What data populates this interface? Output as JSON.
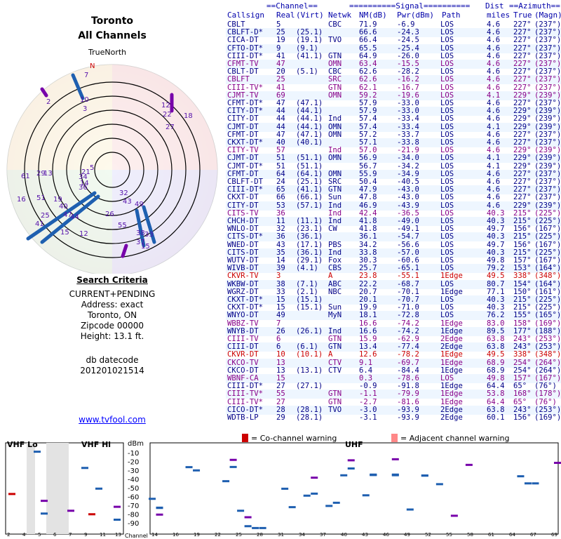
{
  "header": {
    "title1": "Toronto",
    "title2": "All Channels",
    "compass_label": "TrueNorth"
  },
  "polar_labels": [
    "N",
    "7",
    "10",
    "3",
    "2",
    "12",
    "22",
    "18",
    "27",
    "5",
    "61",
    "29",
    "13",
    "16",
    "51",
    "25",
    "36",
    "41",
    "19",
    "40",
    "47",
    "44",
    "32",
    "43",
    "49",
    "26",
    "55",
    "38",
    "33",
    "37",
    "15",
    "21",
    "34",
    "14",
    "12",
    "5",
    "15"
  ],
  "criteria": {
    "heading": "Search Criteria",
    "lines": [
      "CURRENT+PENDING",
      "Address: exact",
      "Toronto, ON",
      "Zipcode 00000",
      "Height: 13.1 ft."
    ],
    "db_lines": [
      "db datecode",
      "201201021514"
    ],
    "site_link": "www.tvfool.com"
  },
  "table": {
    "group_headers": {
      "channel": "==Channel==",
      "signal": "==========Signal==========",
      "dist": "Dist",
      "azimuth": "==Azimuth=="
    },
    "columns": [
      "Callsign",
      "Real",
      "(Virt)",
      "Netwk",
      "NM(dB)",
      "Pwr(dBm)",
      "Path",
      "miles",
      "True",
      "(Magn)"
    ],
    "rows": [
      [
        "CBLT",
        "5",
        "",
        "CBC",
        "71.9",
        "-6.9",
        "LOS",
        "4.6",
        "227°",
        "(237°)",
        "#008"
      ],
      [
        "CBLFT-D*",
        "25",
        "(25.1)",
        "",
        "66.6",
        "-24.3",
        "LOS",
        "4.6",
        "227°",
        "(237°)",
        "#008"
      ],
      [
        "CICA-DT",
        "19",
        "(19.1)",
        "TVO",
        "66.4",
        "-24.5",
        "LOS",
        "4.6",
        "227°",
        "(237°)",
        "#008"
      ],
      [
        "CFTO-DT*",
        "9",
        "(9.1)",
        "",
        "65.5",
        "-25.4",
        "LOS",
        "4.6",
        "227°",
        "(237°)",
        "#008"
      ],
      [
        "CIII-DT*",
        "41",
        "(41.1)",
        "GTN",
        "64.9",
        "-26.0",
        "LOS",
        "4.6",
        "227°",
        "(237°)",
        "#008"
      ],
      [
        "CFMT-TV",
        "47",
        "",
        "OMN",
        "63.4",
        "-15.5",
        "LOS",
        "4.6",
        "227°",
        "(237°)",
        "#808"
      ],
      [
        "CBLT-DT",
        "20",
        "(5.1)",
        "CBC",
        "62.6",
        "-28.2",
        "LOS",
        "4.6",
        "227°",
        "(237°)",
        "#008"
      ],
      [
        "CBLFT",
        "25",
        "",
        "SRC",
        "62.6",
        "-16.2",
        "LOS",
        "4.6",
        "227°",
        "(237°)",
        "#808"
      ],
      [
        "CIII-TV*",
        "41",
        "",
        "GTN",
        "62.1",
        "-16.7",
        "LOS",
        "4.6",
        "227°",
        "(237°)",
        "#808"
      ],
      [
        "CJMT-TV",
        "69",
        "",
        "OMN",
        "59.2",
        "-19.6",
        "LOS",
        "4.1",
        "229°",
        "(239°)",
        "#808"
      ],
      [
        "CFMT-DT*",
        "47",
        "(47.1)",
        "",
        "57.9",
        "-33.0",
        "LOS",
        "4.6",
        "227°",
        "(237°)",
        "#008"
      ],
      [
        "CITY-DT*",
        "44",
        "(44.1)",
        "",
        "57.9",
        "-33.0",
        "LOS",
        "4.6",
        "229°",
        "(239°)",
        "#008"
      ],
      [
        "CITY-DT",
        "44",
        "(44.1)",
        "Ind",
        "57.4",
        "-33.4",
        "LOS",
        "4.6",
        "229°",
        "(239°)",
        "#008"
      ],
      [
        "CJMT-DT",
        "44",
        "(44.1)",
        "OMN",
        "57.4",
        "-33.4",
        "LOS",
        "4.1",
        "229°",
        "(239°)",
        "#008"
      ],
      [
        "CFMT-DT",
        "47",
        "(47.1)",
        "OMN",
        "57.2",
        "-33.7",
        "LOS",
        "4.6",
        "227°",
        "(237°)",
        "#008"
      ],
      [
        "CKXT-DT*",
        "40",
        "(40.1)",
        "",
        "57.1",
        "-33.8",
        "LOS",
        "4.6",
        "227°",
        "(237°)",
        "#008"
      ],
      [
        "CITY-TV",
        "57",
        "",
        "Ind",
        "57.0",
        "-21.9",
        "LOS",
        "4.6",
        "229°",
        "(239°)",
        "#808"
      ],
      [
        "CJMT-DT",
        "51",
        "(51.1)",
        "OMN",
        "56.9",
        "-34.0",
        "LOS",
        "4.1",
        "229°",
        "(239°)",
        "#008"
      ],
      [
        "CJMT-DT*",
        "51",
        "(51.1)",
        "",
        "56.7",
        "-34.2",
        "LOS",
        "4.1",
        "229°",
        "(239°)",
        "#008"
      ],
      [
        "CFMT-DT",
        "64",
        "(64.1)",
        "OMN",
        "55.9",
        "-34.9",
        "LOS",
        "4.6",
        "227°",
        "(237°)",
        "#008"
      ],
      [
        "CBLFT-DT",
        "24",
        "(25.1)",
        "SRC",
        "50.4",
        "-40.5",
        "LOS",
        "4.6",
        "227°",
        "(237°)",
        "#008"
      ],
      [
        "CIII-DT*",
        "65",
        "(41.1)",
        "GTN",
        "47.9",
        "-43.0",
        "LOS",
        "4.6",
        "227°",
        "(237°)",
        "#008"
      ],
      [
        "CKXT-DT",
        "66",
        "(66.1)",
        "Sun",
        "47.8",
        "-43.0",
        "LOS",
        "4.6",
        "227°",
        "(237°)",
        "#008"
      ],
      [
        "CITY-DT",
        "53",
        "(57.1)",
        "Ind",
        "46.9",
        "-43.9",
        "LOS",
        "4.6",
        "229°",
        "(239°)",
        "#008"
      ],
      [
        "CITS-TV",
        "36",
        "",
        "Ind",
        "42.4",
        "-36.5",
        "LOS",
        "40.3",
        "215°",
        "(225°)",
        "#808"
      ],
      [
        "CHCH-DT",
        "11",
        "(11.1)",
        "Ind",
        "41.8",
        "-49.0",
        "LOS",
        "40.3",
        "215°",
        "(225°)",
        "#008"
      ],
      [
        "WNLO-DT",
        "32",
        "(23.1)",
        "CW",
        "41.8",
        "-49.1",
        "LOS",
        "49.7",
        "156°",
        "(167°)",
        "#008"
      ],
      [
        "CITS-DT*",
        "36",
        "(36.1)",
        "",
        "36.1",
        "-54.7",
        "LOS",
        "40.3",
        "215°",
        "(225°)",
        "#008"
      ],
      [
        "WNED-DT",
        "43",
        "(17.1)",
        "PBS",
        "34.2",
        "-56.6",
        "LOS",
        "49.7",
        "156°",
        "(167°)",
        "#008"
      ],
      [
        "CITS-DT",
        "35",
        "(36.1)",
        "Ind",
        "33.8",
        "-57.0",
        "LOS",
        "40.3",
        "215°",
        "(225°)",
        "#008"
      ],
      [
        "WUTV-DT",
        "14",
        "(29.1)",
        "Fox",
        "30.3",
        "-60.6",
        "LOS",
        "49.8",
        "157°",
        "(167°)",
        "#008"
      ],
      [
        "WIVB-DT",
        "39",
        "(4.1)",
        "CBS",
        "25.7",
        "-65.1",
        "LOS",
        "79.2",
        "153°",
        "(164°)",
        "#008"
      ],
      [
        "CKVR-TV",
        "3",
        "",
        "A",
        "23.8",
        "-55.1",
        "1Edge",
        "49.5",
        "338°",
        "(348°)",
        "#c00"
      ],
      [
        "WKBW-DT",
        "38",
        "(7.1)",
        "ABC",
        "22.2",
        "-68.7",
        "LOS",
        "80.7",
        "154°",
        "(164°)",
        "#008"
      ],
      [
        "WGRZ-DT",
        "33",
        "(2.1)",
        "NBC",
        "20.7",
        "-70.1",
        "1Edge",
        "77.1",
        "150°",
        "(161°)",
        "#008"
      ],
      [
        "CKXT-DT*",
        "15",
        "(15.1)",
        "",
        "20.1",
        "-70.7",
        "LOS",
        "40.3",
        "215°",
        "(225°)",
        "#008"
      ],
      [
        "CKXT-DT*",
        "15",
        "(15.1)",
        "Sun",
        "19.9",
        "-71.0",
        "LOS",
        "40.3",
        "215°",
        "(225°)",
        "#008"
      ],
      [
        "WNYO-DT",
        "49",
        "",
        "MyN",
        "18.1",
        "-72.8",
        "LOS",
        "76.2",
        "155°",
        "(165°)",
        "#008"
      ],
      [
        "WBBZ-TV",
        "7",
        "",
        "",
        "16.6",
        "-74.2",
        "1Edge",
        "83.0",
        "158°",
        "(169°)",
        "#808"
      ],
      [
        "WNYB-DT",
        "26",
        "(26.1)",
        "Ind",
        "16.6",
        "-74.2",
        "1Edge",
        "89.5",
        "177°",
        "(188°)",
        "#008"
      ],
      [
        "CIII-TV",
        "6",
        "",
        "GTN",
        "15.9",
        "-62.9",
        "2Edge",
        "63.8",
        "243°",
        "(253°)",
        "#808"
      ],
      [
        "CIII-DT",
        "6",
        "(6.1)",
        "GTN",
        "13.4",
        "-77.4",
        "2Edge",
        "63.8",
        "243°",
        "(253°)",
        "#008"
      ],
      [
        "CKVR-DT",
        "10",
        "(10.1)",
        "A",
        "12.6",
        "-78.2",
        "1Edge",
        "49.5",
        "338°",
        "(348°)",
        "#c00"
      ],
      [
        "CKCO-TV",
        "13",
        "",
        "CTV",
        "9.1",
        "-69.7",
        "1Edge",
        "68.9",
        "254°",
        "(264°)",
        "#808"
      ],
      [
        "CKCO-DT",
        "13",
        "(13.1)",
        "CTV",
        "6.4",
        "-84.4",
        "1Edge",
        "68.9",
        "254°",
        "(264°)",
        "#008"
      ],
      [
        "WBNF-CA",
        "15",
        "",
        "",
        "0.3",
        "-78.6",
        "LOS",
        "49.8",
        "157°",
        "(167°)",
        "#808"
      ],
      [
        "CIII-DT*",
        "27",
        "(27.1)",
        "",
        "-0.9",
        "-91.8",
        "1Edge",
        "64.4",
        "65°",
        "(76°)",
        "#008"
      ],
      [
        "CIII-TV*",
        "55",
        "",
        "GTN",
        "-1.1",
        "-79.9",
        "1Edge",
        "53.8",
        "168°",
        "(178°)",
        "#808"
      ],
      [
        "CIII-TV*",
        "27",
        "",
        "GTN",
        "-2.7",
        "-81.6",
        "1Edge",
        "64.4",
        "65°",
        "(76°)",
        "#808"
      ],
      [
        "CICO-DT*",
        "28",
        "(28.1)",
        "TVO",
        "-3.0",
        "-93.9",
        "2Edge",
        "63.8",
        "243°",
        "(253°)",
        "#008"
      ],
      [
        "WDTB-LP",
        "29",
        "(28.1)",
        "",
        "-3.1",
        "-93.9",
        "2Edge",
        "60.1",
        "156°",
        "(169°)",
        "#008"
      ]
    ]
  },
  "bottom": {
    "vhf_lo": "VHF Lo",
    "vhf_hi": "VHF Hi",
    "uhf": "UHF",
    "dbm": "dBm",
    "channel": "Channel",
    "co_warn": "= Co-channel warning",
    "adj_warn": "= Adjacent channel warning",
    "yticks": [
      "-10",
      "-20",
      "-30",
      "-40",
      "-50",
      "-60",
      "-70",
      "-80",
      "-90"
    ],
    "vhf_ticks": [
      "2",
      "4",
      "5",
      "6",
      "7",
      "9",
      "11",
      "13"
    ],
    "uhf_ticks": [
      "14",
      "16",
      "19",
      "22",
      "25",
      "28",
      "31",
      "34",
      "37",
      "40",
      "43",
      "46",
      "49",
      "52",
      "55",
      "58",
      "61",
      "64",
      "67",
      "69"
    ]
  }
}
